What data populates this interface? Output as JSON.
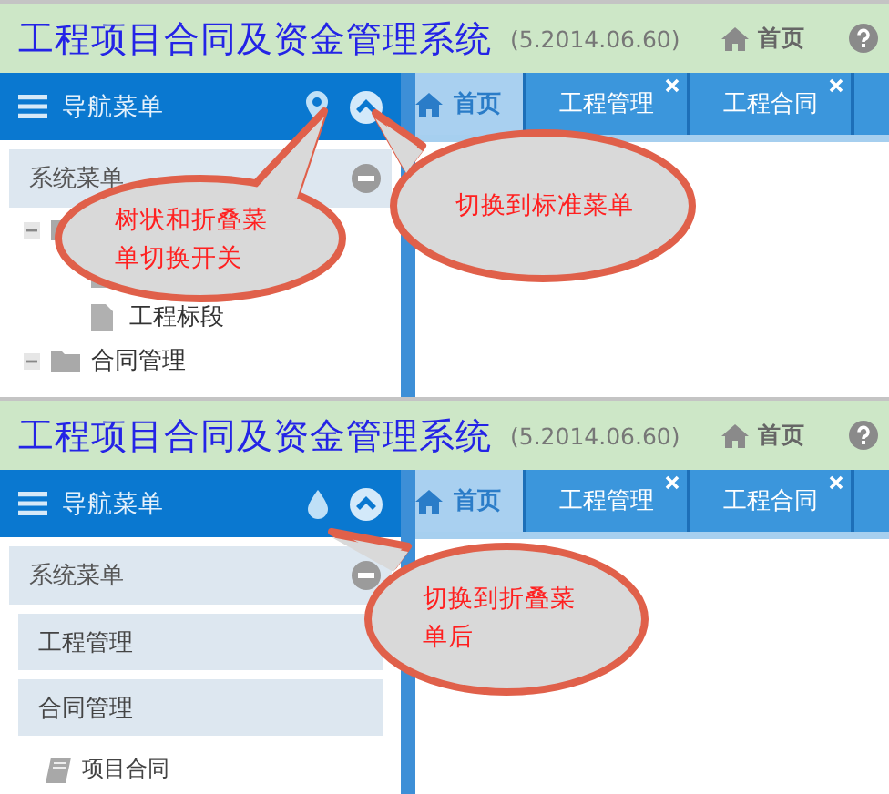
{
  "panels": [
    {
      "header": {
        "title": "工程项目合同及资金管理系统",
        "version": "(5.2014.06.60)",
        "home_link": "首页"
      },
      "nav": {
        "title": "导航菜单"
      },
      "sidebar": {
        "section": "系统菜单",
        "kind": "tree",
        "items": [
          {
            "kind": "folder",
            "expanded": true,
            "children": [
              {
                "kind": "file"
              },
              {
                "label": "工程标段",
                "kind": "file"
              }
            ]
          },
          {
            "label": "合同管理",
            "kind": "folder",
            "expanded": true
          }
        ]
      },
      "tabs": [
        {
          "label": "首页",
          "selected": true,
          "closable": false
        },
        {
          "label": "工程管理",
          "selected": false,
          "closable": true
        },
        {
          "label": "工程合同",
          "selected": false,
          "closable": true
        }
      ],
      "callouts": [
        {
          "text": "树状和折叠菜单切换开关"
        },
        {
          "text": "切换到标准菜单"
        }
      ]
    },
    {
      "header": {
        "title": "工程项目合同及资金管理系统",
        "version": "(5.2014.06.60)",
        "home_link": "首页"
      },
      "nav": {
        "title": "导航菜单"
      },
      "sidebar": {
        "section": "系统菜单",
        "kind": "accordion",
        "items": [
          {
            "label": "工程管理",
            "kind": "section"
          },
          {
            "label": "合同管理",
            "kind": "section"
          },
          {
            "label": "项目合同",
            "kind": "leaf"
          }
        ]
      },
      "tabs": [
        {
          "label": "首页",
          "selected": true,
          "closable": false
        },
        {
          "label": "工程管理",
          "selected": false,
          "closable": true
        },
        {
          "label": "工程合同",
          "selected": false,
          "closable": true
        }
      ],
      "callouts": [
        {
          "text": "切换到折叠菜单后"
        }
      ]
    }
  ]
}
